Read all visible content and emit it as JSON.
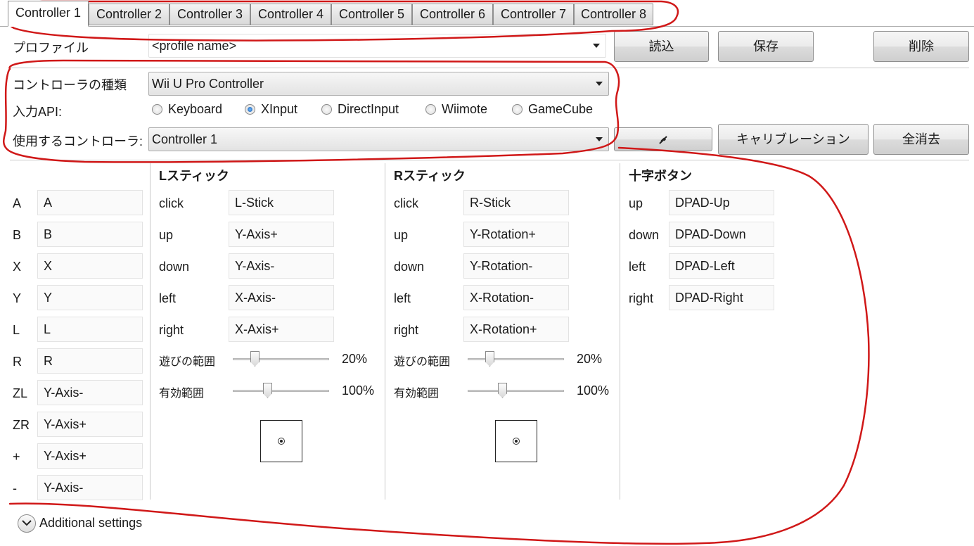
{
  "tabs": [
    "Controller 1",
    "Controller 2",
    "Controller 3",
    "Controller 4",
    "Controller 5",
    "Controller 6",
    "Controller 7",
    "Controller 8"
  ],
  "profile": {
    "label": "プロファイル",
    "value": "<profile name>",
    "load": "読込",
    "save": "保存",
    "delete": "削除"
  },
  "controller_type": {
    "label": "コントローラの種類",
    "value": "Wii U Pro Controller"
  },
  "input_api": {
    "label": "入力API:",
    "options": [
      "Keyboard",
      "XInput",
      "DirectInput",
      "Wiimote",
      "GameCube"
    ],
    "selected": "XInput"
  },
  "use_controller": {
    "label": "使用するコントローラ:",
    "value": "Controller 1",
    "calibrate": "キャリブレーション",
    "clear_all": "全消去",
    "connect_icon": "plug-icon"
  },
  "buttons": [
    {
      "label": "A",
      "value": "A"
    },
    {
      "label": "B",
      "value": "B"
    },
    {
      "label": "X",
      "value": "X"
    },
    {
      "label": "Y",
      "value": "Y"
    },
    {
      "label": "L",
      "value": "L"
    },
    {
      "label": "R",
      "value": "R"
    },
    {
      "label": "ZL",
      "value": "Y-Axis-"
    },
    {
      "label": "ZR",
      "value": "Y-Axis+"
    },
    {
      "label": "+",
      "value": "Y-Axis+"
    },
    {
      "label": "-",
      "value": "Y-Axis-"
    }
  ],
  "lstick": {
    "title": "Lスティック",
    "rows": [
      {
        "label": "click",
        "value": "L-Stick"
      },
      {
        "label": "up",
        "value": "Y-Axis+"
      },
      {
        "label": "down",
        "value": "Y-Axis-"
      },
      {
        "label": "left",
        "value": "X-Axis-"
      },
      {
        "label": "right",
        "value": "X-Axis+"
      }
    ],
    "deadzone": {
      "label": "遊びの範囲",
      "value": "20%",
      "fraction": 0.2
    },
    "range": {
      "label": "有効範囲",
      "value": "100%",
      "fraction": 0.35
    }
  },
  "rstick": {
    "title": "Rスティック",
    "rows": [
      {
        "label": "click",
        "value": "R-Stick"
      },
      {
        "label": "up",
        "value": "Y-Rotation+"
      },
      {
        "label": "down",
        "value": "Y-Rotation-"
      },
      {
        "label": "left",
        "value": "X-Rotation-"
      },
      {
        "label": "right",
        "value": "X-Rotation+"
      }
    ],
    "deadzone": {
      "label": "遊びの範囲",
      "value": "20%",
      "fraction": 0.2
    },
    "range": {
      "label": "有効範囲",
      "value": "100%",
      "fraction": 0.35
    }
  },
  "dpad": {
    "title": "十字ボタン",
    "rows": [
      {
        "label": "up",
        "value": "DPAD-Up"
      },
      {
        "label": "down",
        "value": "DPAD-Down"
      },
      {
        "label": "left",
        "value": "DPAD-Left"
      },
      {
        "label": "right",
        "value": "DPAD-Right"
      }
    ]
  },
  "additional": "Additional settings",
  "annotation_color": "#d01818"
}
